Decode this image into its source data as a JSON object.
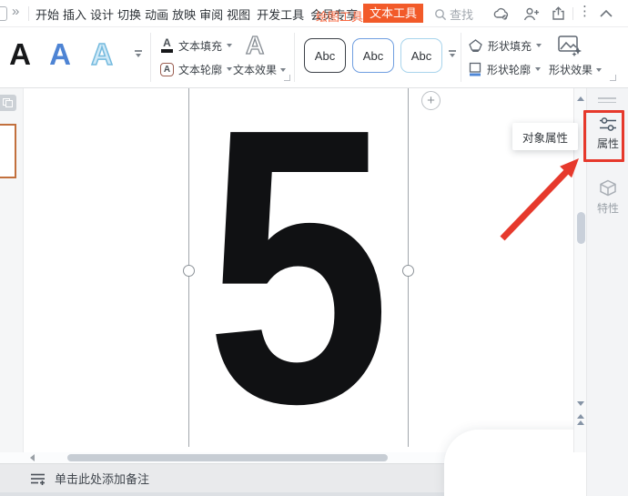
{
  "menu": {
    "tabs": [
      "开始",
      "插入",
      "设计",
      "切换",
      "动画",
      "放映",
      "审阅",
      "视图",
      "开发工具",
      "会员专享"
    ],
    "context_tabs": {
      "drawing": "绘图工具",
      "text": "文本工具"
    },
    "search_label": "查找"
  },
  "ribbon": {
    "text_style_samples": [
      "A",
      "A",
      "A"
    ],
    "text_fill_label": "文本填充",
    "text_outline_label": "文本轮廓",
    "text_effects_label": "文本效果",
    "text_outline_icon_letter": "A",
    "text_fill_icon_letter": "A",
    "text_effects_icon_letter": "A",
    "shape_style_samples": [
      "Abc",
      "Abc",
      "Abc"
    ],
    "shape_fill_label": "形状填充",
    "shape_outline_label": "形状轮廓",
    "shape_effects_label": "形状效果"
  },
  "canvas": {
    "slide_text": "5"
  },
  "right_panel": {
    "properties_label": "属性",
    "features_label": "特性"
  },
  "tooltip": {
    "text": "对象属性"
  },
  "notes": {
    "placeholder": "单击此处添加备注"
  },
  "colors": {
    "accent_orange": "#f25a29",
    "context_tab_text": "#f96a43",
    "highlight_red": "#e6392c",
    "selected_thumb_border": "#c2703d",
    "style_blue": "#4e84d4",
    "style_light_blue": "#74bade"
  }
}
